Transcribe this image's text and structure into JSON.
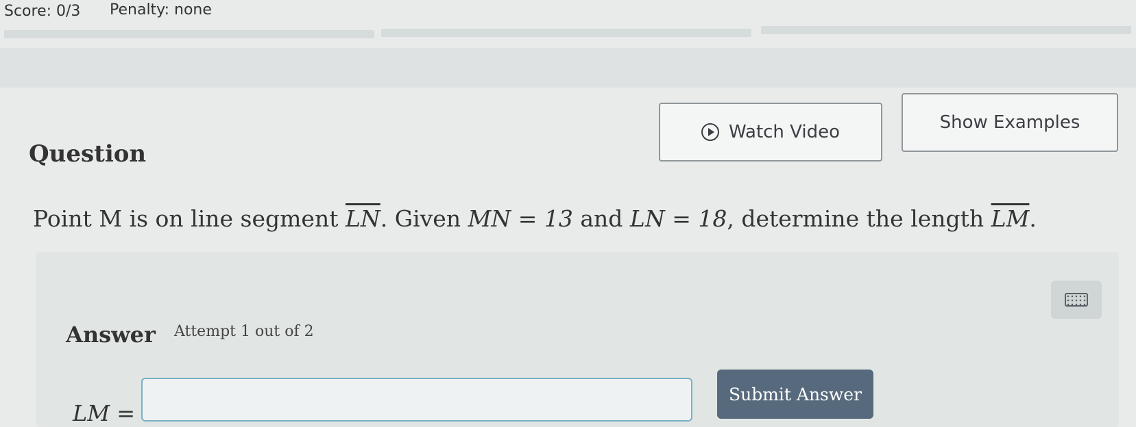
{
  "header": {
    "score": "Score: 0/3",
    "penalty": "Penalty: none"
  },
  "question": {
    "title": "Question",
    "watch_video_label": "Watch Video",
    "show_examples_label": "Show Examples",
    "prompt_parts": {
      "p1": "Point M is on line segment ",
      "seg1": "LN",
      "p2": ". Given ",
      "eq1": "MN = 13",
      "p3": " and ",
      "eq2": "LN = 18",
      "p4": ", determine the length ",
      "seg2": "LM",
      "p5": "."
    }
  },
  "answer": {
    "label": "Answer",
    "attempt": "Attempt 1 out of 2",
    "field_label": "LM =",
    "input_value": "",
    "submit_label": "Submit Answer"
  },
  "colors": {
    "submit_bg": "#576a7d",
    "input_border": "#7ab0c6"
  },
  "icons": {
    "watch_video": "play-circle-icon",
    "keyboard": "keyboard-icon"
  }
}
